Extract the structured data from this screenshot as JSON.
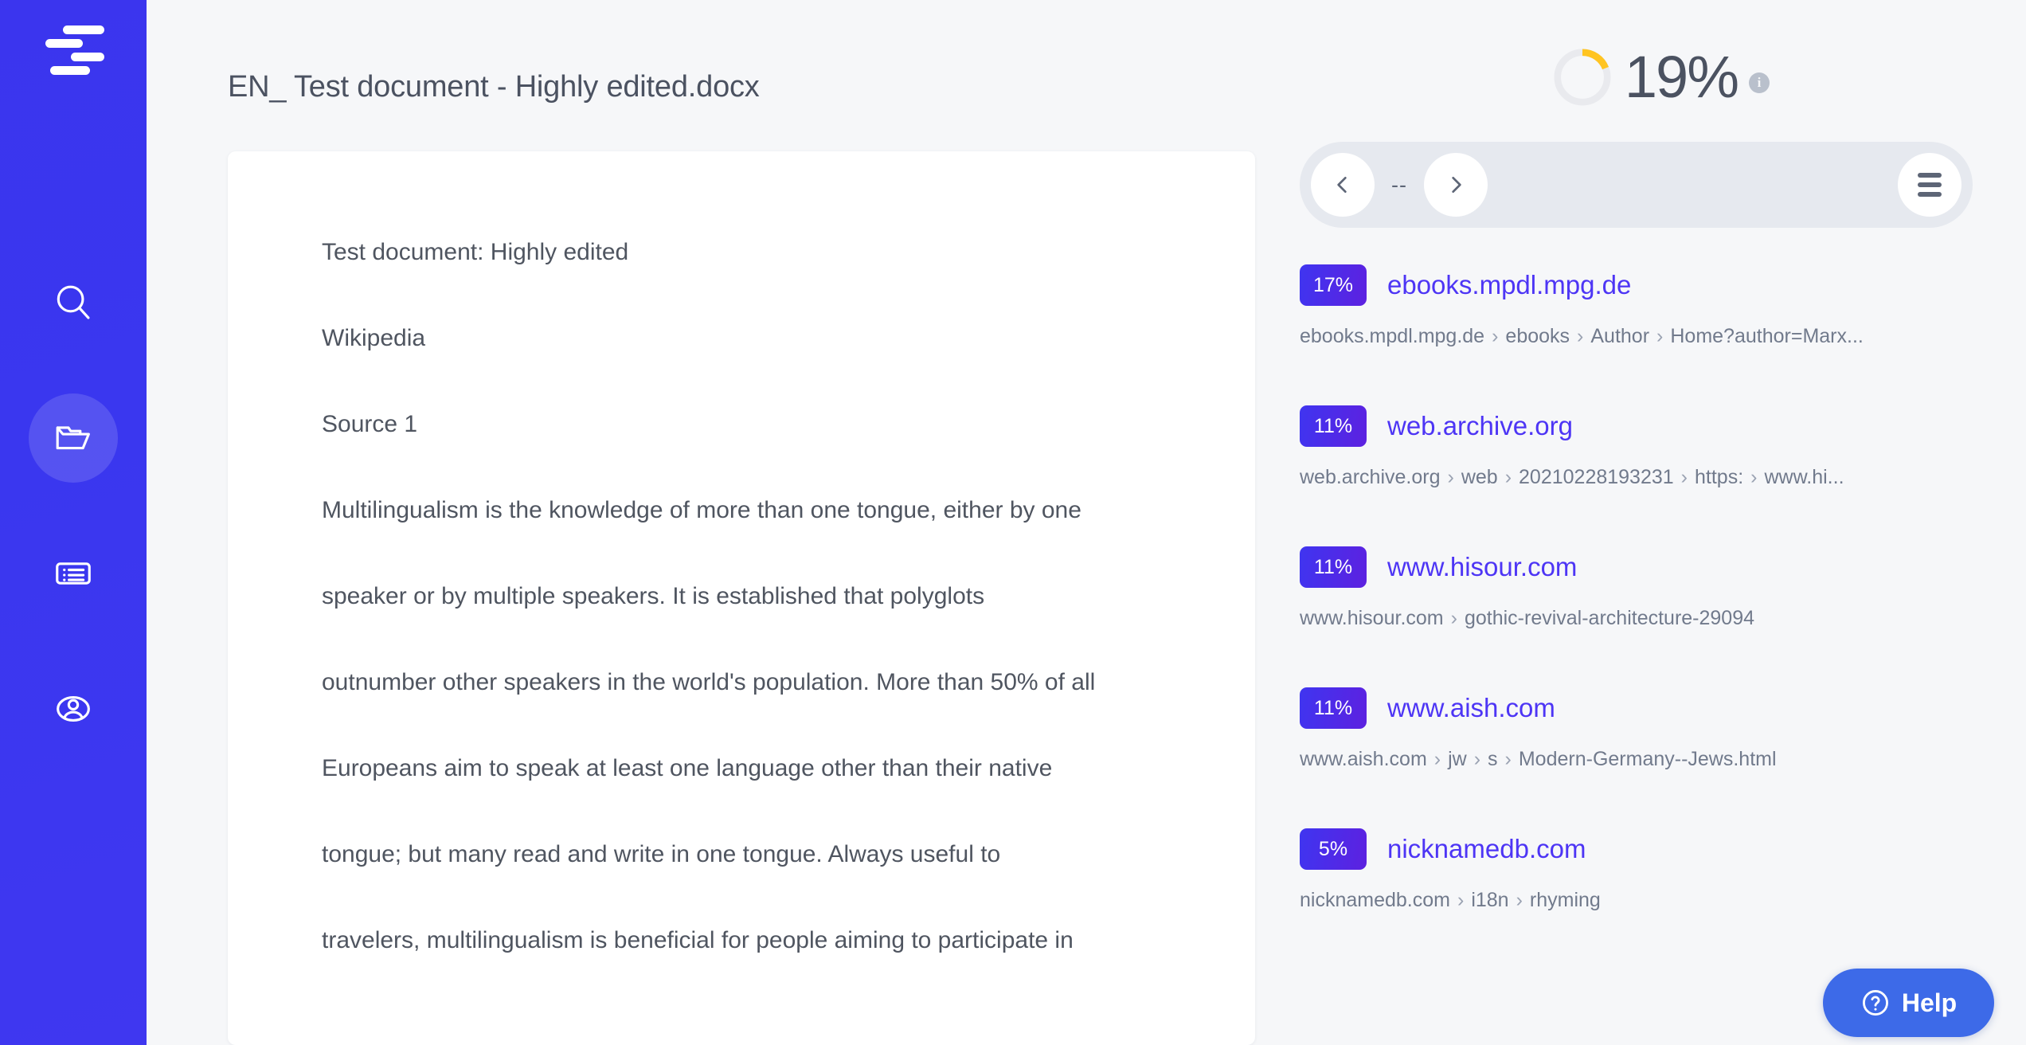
{
  "sidebar": {
    "logo_name": "plagiarism-checker-logo",
    "items": [
      {
        "icon": "search-icon",
        "name": "sidebar-item-search",
        "active": false
      },
      {
        "icon": "folder-icon",
        "name": "sidebar-item-documents",
        "active": true
      },
      {
        "icon": "list-icon",
        "name": "sidebar-item-reports",
        "active": false
      },
      {
        "icon": "user-icon",
        "name": "sidebar-item-account",
        "active": false
      }
    ]
  },
  "header": {
    "document_title": "EN_ Test document - Highly edited.docx",
    "score": {
      "value": "19%",
      "percent": 19,
      "arc_color": "#ffc422",
      "track_color": "#e9eaee",
      "text_color": "#4b5261",
      "info_icon": "info-icon"
    }
  },
  "document": {
    "lines": [
      "Test document: Highly edited",
      "Wikipedia",
      "Source 1",
      "Multilingualism is the knowledge of more than one tongue, either by one",
      "speaker or by multiple speakers. It is established that polyglots",
      "outnumber other speakers in the world's population. More than 50% of all",
      "Europeans aim to speak at least one language other than their native",
      "tongue; but many read and write in one tongue. Always useful to",
      "travelers, multilingualism is beneficial for people aiming to participate in"
    ]
  },
  "sources_panel": {
    "nav": {
      "prev_icon": "chevron-left-icon",
      "counter": "--",
      "next_icon": "chevron-right-icon",
      "menu_icon": "hamburger-menu-icon"
    },
    "accent_color": "#4d35f5",
    "badge_gradient_from": "#3f35f0",
    "badge_gradient_to": "#5d21e0",
    "sources": [
      {
        "percent": "17%",
        "domain": "ebooks.mpdl.mpg.de",
        "path": [
          "ebooks.mpdl.mpg.de",
          "ebooks",
          "Author",
          "Home?author=Marx..."
        ]
      },
      {
        "percent": "11%",
        "domain": "web.archive.org",
        "path": [
          "web.archive.org",
          "web",
          "20210228193231",
          "https:",
          "",
          "www.hi..."
        ]
      },
      {
        "percent": "11%",
        "domain": "www.hisour.com",
        "path": [
          "www.hisour.com",
          "gothic-revival-architecture-29094"
        ]
      },
      {
        "percent": "11%",
        "domain": "www.aish.com",
        "path": [
          "www.aish.com",
          "jw",
          "s",
          "Modern-Germany--Jews.html"
        ]
      },
      {
        "percent": "5%",
        "domain": "nicknamedb.com",
        "path": [
          "nicknamedb.com",
          "i18n",
          "rhyming"
        ]
      }
    ]
  },
  "help": {
    "label": "Help",
    "icon": "question-mark-circle-icon",
    "color": "#3d6ae8"
  }
}
